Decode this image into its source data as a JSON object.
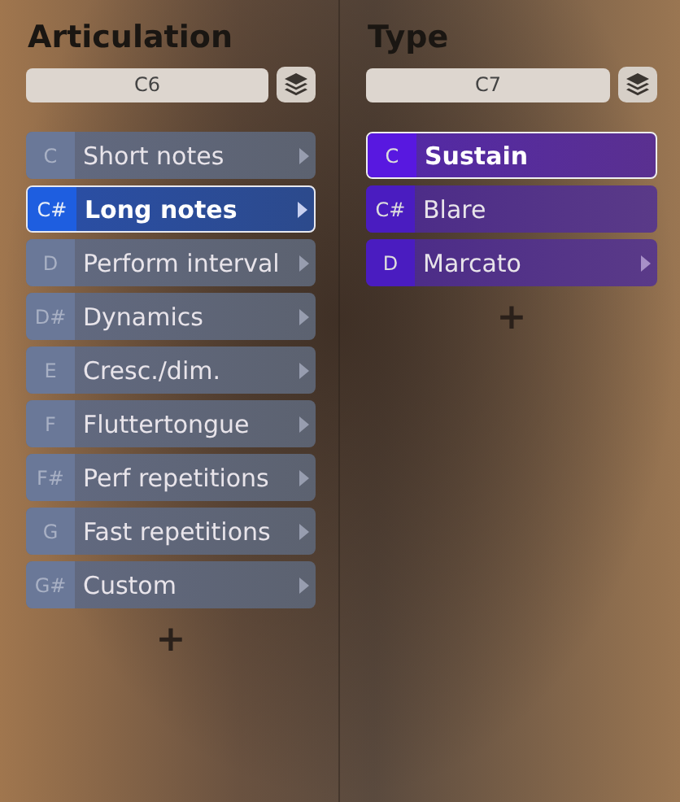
{
  "columns": [
    {
      "title": "Articulation",
      "range": "C6",
      "items": [
        {
          "note": "C",
          "label": "Short notes",
          "selected": false,
          "has_submenu": true
        },
        {
          "note": "C#",
          "label": "Long notes",
          "selected": true,
          "has_submenu": true
        },
        {
          "note": "D",
          "label": "Perform interval",
          "selected": false,
          "has_submenu": true
        },
        {
          "note": "D#",
          "label": "Dynamics",
          "selected": false,
          "has_submenu": true
        },
        {
          "note": "E",
          "label": "Cresc./dim.",
          "selected": false,
          "has_submenu": true
        },
        {
          "note": "F",
          "label": "Fluttertongue",
          "selected": false,
          "has_submenu": true
        },
        {
          "note": "F#",
          "label": "Perf repetitions",
          "selected": false,
          "has_submenu": true
        },
        {
          "note": "G",
          "label": "Fast repetitions",
          "selected": false,
          "has_submenu": true
        },
        {
          "note": "G#",
          "label": "Custom",
          "selected": false,
          "has_submenu": true
        }
      ],
      "add": "+"
    },
    {
      "title": "Type",
      "range": "C7",
      "items": [
        {
          "note": "C",
          "label": "Sustain",
          "selected": true,
          "has_submenu": false
        },
        {
          "note": "C#",
          "label": "Blare",
          "selected": false,
          "has_submenu": false
        },
        {
          "note": "D",
          "label": "Marcato",
          "selected": false,
          "has_submenu": true
        }
      ],
      "add": "+"
    }
  ]
}
